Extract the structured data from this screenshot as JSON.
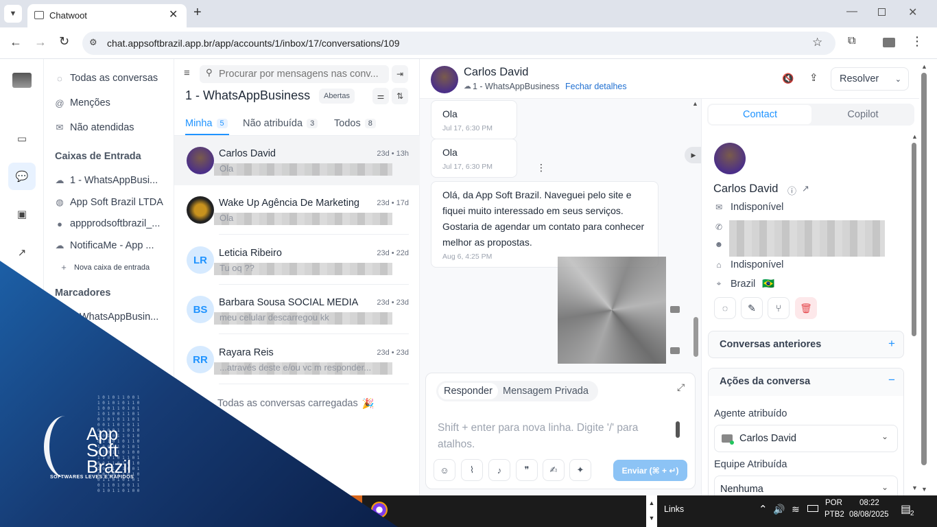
{
  "browser": {
    "tab_title": "Chatwoot",
    "url": "chat.appsoftbrazil.app.br/app/accounts/1/inbox/17/conversations/109"
  },
  "sidebar": {
    "items": [
      "Todas as conversas",
      "Menções",
      "Não atendidas"
    ],
    "inbox_header": "Caixas de Entrada",
    "inboxes": [
      "1 - WhatsAppBusi...",
      "App Soft Brazil LTDA",
      "appprodsoftbrazil_...",
      "NotificaMe - App ..."
    ],
    "new_inbox": "Nova caixa de entrada",
    "labels_header": "Marcadores",
    "labels": [
      "WhatsAppBusin..."
    ]
  },
  "list": {
    "search_placeholder": "Procurar por mensagens nas conv...",
    "title": "1 - WhatsAppBusiness",
    "status": "Abertas",
    "tabs": [
      {
        "label": "Minha",
        "count": "5"
      },
      {
        "label": "Não atribuída",
        "count": "3"
      },
      {
        "label": "Todos",
        "count": "8"
      }
    ],
    "rows": [
      {
        "initials": "",
        "name": "Carlos David",
        "time": "23d • 13h",
        "preview": "Ola"
      },
      {
        "initials": "",
        "name": "Wake Up Agência De Marketing",
        "time": "23d • 17d",
        "preview": "Ola"
      },
      {
        "initials": "LR",
        "name": "Leticia Ribeiro",
        "time": "23d • 22d",
        "preview": "Tu oq ??"
      },
      {
        "initials": "BS",
        "name": "Barbara Sousa SOCIAL MEDIA",
        "time": "23d • 23d",
        "preview": "meu celular descarregou kk"
      },
      {
        "initials": "RR",
        "name": "Rayara Reis",
        "time": "23d • 23d",
        "preview": "...através deste e/ou vc m responder..."
      }
    ],
    "footer": "Todas as conversas carregadas",
    "footer_emoji": "🎉"
  },
  "conversation": {
    "contact_name": "Carlos David",
    "inbox": "1 - WhatsAppBusiness",
    "close_details": "Fechar detalhes",
    "resolve": "Resolver",
    "messages": [
      {
        "text": "Ola",
        "time": "Jul 17, 6:30 PM"
      },
      {
        "text": "Ola",
        "time": "Jul 17, 6:30 PM"
      },
      {
        "text": "Olá, da App Soft Brazil. Naveguei pelo site e fiquei muito interessado em seus serviços. Gostaria de agendar um contato para conhecer melhor as propostas.",
        "time": "Aug 6, 4:25 PM"
      }
    ],
    "reply_tab": "Responder",
    "private_tab": "Mensagem Privada",
    "composer_placeholder": "Shift + enter para nova linha. Digite '/' para atalhos.",
    "send": "Enviar (⌘ + ↵)"
  },
  "panel": {
    "tabs": [
      "Contact",
      "Copilot"
    ],
    "name": "Carlos David",
    "email": "Indisponível",
    "company": "Indisponível",
    "country": "Brazil",
    "country_flag": "🇧🇷",
    "previous": "Conversas anteriores",
    "actions": "Ações da conversa",
    "agent_label": "Agente atribuído",
    "agent": "Carlos David",
    "team_label": "Equipe Atribuída",
    "team": "Nenhuma"
  },
  "taskbar": {
    "links": "Links",
    "lang1": "POR",
    "lang2": "PTB2",
    "time": "08:22",
    "date": "08/08/2025",
    "notif": "2"
  },
  "brand": {
    "line1": "App",
    "line2": "Soft",
    "line3": "Brazil",
    "tagline": "SOFTWARES LEVES E RÁPIDOS"
  },
  "colors": {
    "accent": "#1f93ff",
    "tabbar": "#dfe3eb"
  }
}
